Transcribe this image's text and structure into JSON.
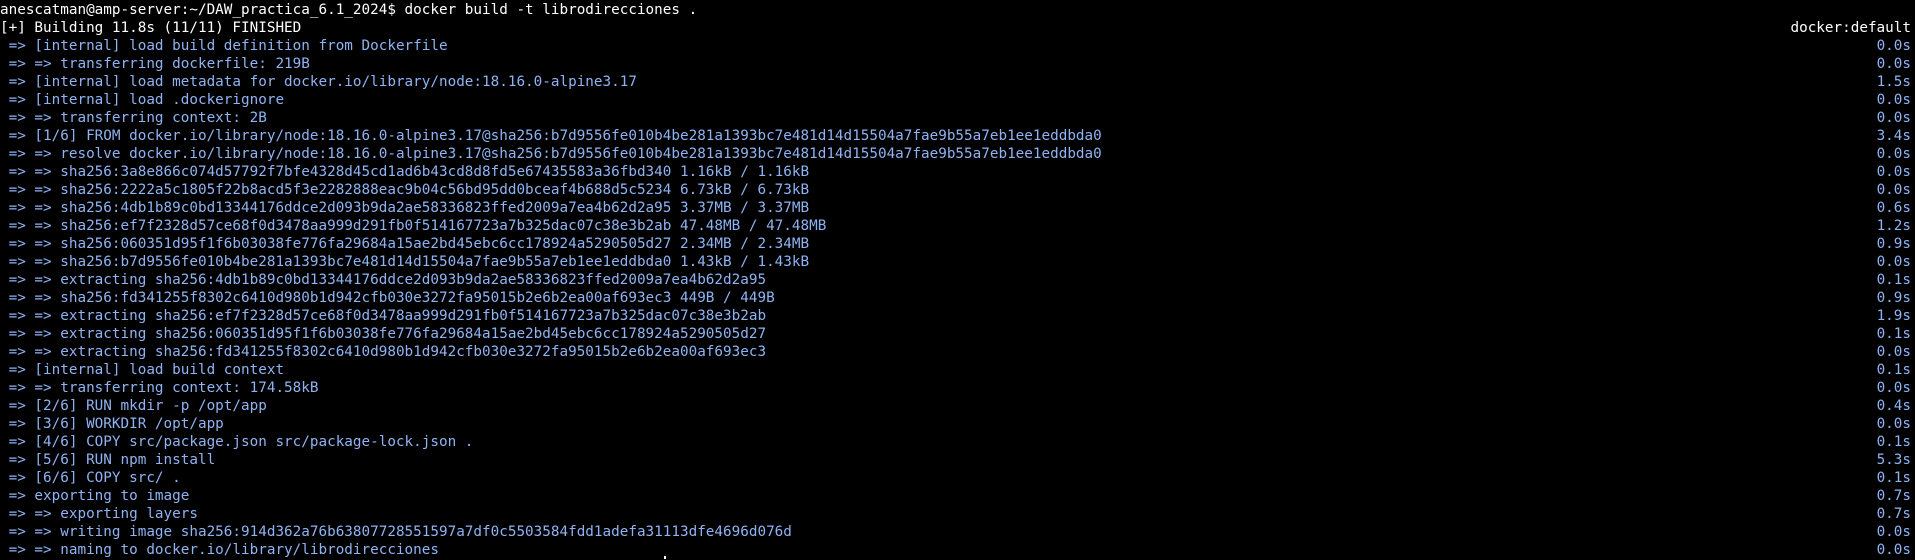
{
  "terminal": {
    "prompt": "anescatman@amp-server:~/DAW_practica_6.1_2024$ docker build -t librodirecciones .",
    "status": "[+] Building 11.8s (11/11) FINISHED",
    "builder": "docker:default",
    "steps": [
      {
        "text": " => [internal] load build definition from Dockerfile",
        "time": "0.0s"
      },
      {
        "text": " => => transferring dockerfile: 219B",
        "time": "0.0s"
      },
      {
        "text": " => [internal] load metadata for docker.io/library/node:18.16.0-alpine3.17",
        "time": "1.5s"
      },
      {
        "text": " => [internal] load .dockerignore",
        "time": "0.0s"
      },
      {
        "text": " => => transferring context: 2B",
        "time": "0.0s"
      },
      {
        "text": " => [1/6] FROM docker.io/library/node:18.16.0-alpine3.17@sha256:b7d9556fe010b4be281a1393bc7e481d14d15504a7fae9b55a7eb1ee1eddbda0",
        "time": "3.4s"
      },
      {
        "text": " => => resolve docker.io/library/node:18.16.0-alpine3.17@sha256:b7d9556fe010b4be281a1393bc7e481d14d15504a7fae9b55a7eb1ee1eddbda0",
        "time": "0.0s"
      },
      {
        "text": " => => sha256:3a8e866c074d57792f7bfe4328d45cd1ad6b43cd8d8fd5e67435583a36fbd340 1.16kB / 1.16kB",
        "time": "0.0s"
      },
      {
        "text": " => => sha256:2222a5c1805f22b8acd5f3e2282888eac9b04c56bd95dd0bceaf4b688d5c5234 6.73kB / 6.73kB",
        "time": "0.0s"
      },
      {
        "text": " => => sha256:4db1b89c0bd13344176ddce2d093b9da2ae58336823ffed2009a7ea4b62d2a95 3.37MB / 3.37MB",
        "time": "0.6s"
      },
      {
        "text": " => => sha256:ef7f2328d57ce68f0d3478aa999d291fb0f514167723a7b325dac07c38e3b2ab 47.48MB / 47.48MB",
        "time": "1.2s"
      },
      {
        "text": " => => sha256:060351d95f1f6b03038fe776fa29684a15ae2bd45ebc6cc178924a5290505d27 2.34MB / 2.34MB",
        "time": "0.9s"
      },
      {
        "text": " => => sha256:b7d9556fe010b4be281a1393bc7e481d14d15504a7fae9b55a7eb1ee1eddbda0 1.43kB / 1.43kB",
        "time": "0.0s"
      },
      {
        "text": " => => extracting sha256:4db1b89c0bd13344176ddce2d093b9da2ae58336823ffed2009a7ea4b62d2a95",
        "time": "0.1s"
      },
      {
        "text": " => => sha256:fd341255f8302c6410d980b1d942cfb030e3272fa95015b2e6b2ea00af693ec3 449B / 449B",
        "time": "0.9s"
      },
      {
        "text": " => => extracting sha256:ef7f2328d57ce68f0d3478aa999d291fb0f514167723a7b325dac07c38e3b2ab",
        "time": "1.9s"
      },
      {
        "text": " => => extracting sha256:060351d95f1f6b03038fe776fa29684a15ae2bd45ebc6cc178924a5290505d27",
        "time": "0.1s"
      },
      {
        "text": " => => extracting sha256:fd341255f8302c6410d980b1d942cfb030e3272fa95015b2e6b2ea00af693ec3",
        "time": "0.0s"
      },
      {
        "text": " => [internal] load build context",
        "time": "0.1s"
      },
      {
        "text": " => => transferring context: 174.58kB",
        "time": "0.0s"
      },
      {
        "text": " => [2/6] RUN mkdir -p /opt/app",
        "time": "0.4s"
      },
      {
        "text": " => [3/6] WORKDIR /opt/app",
        "time": "0.0s"
      },
      {
        "text": " => [4/6] COPY src/package.json src/package-lock.json .",
        "time": "0.1s"
      },
      {
        "text": " => [5/6] RUN npm install",
        "time": "5.3s"
      },
      {
        "text": " => [6/6] COPY src/ .",
        "time": "0.1s"
      },
      {
        "text": " => exporting to image",
        "time": "0.7s"
      },
      {
        "text": " => => exporting layers",
        "time": "0.7s"
      },
      {
        "text": " => => writing image sha256:914d362a76b63807728551597a7df0c5503584fdd1adefa31113dfe4696d076d",
        "time": "0.0s"
      },
      {
        "text": " => => naming to docker.io/library/librodirecciones",
        "time": "0.0s"
      }
    ]
  }
}
